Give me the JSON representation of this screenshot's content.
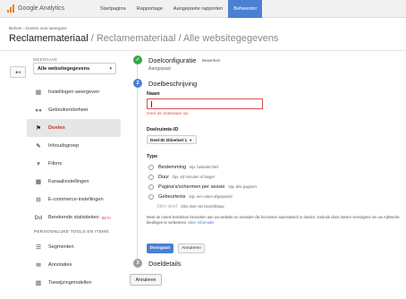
{
  "app": {
    "name": "Google Analytics",
    "brand_color": "#f57c00",
    "nav_tabs": [
      {
        "label": "Startpagina"
      },
      {
        "label": "Rapportage"
      },
      {
        "label": "Aangepaste rapporten"
      },
      {
        "label": "Beheerder",
        "active": true
      }
    ]
  },
  "breadcrumb": "Beheer › Doelen voor weergave",
  "page_title": {
    "main": "Reclamemateriaal",
    "sub": " / Reclamemateriaal / Alle websitegegevens"
  },
  "sidebar": {
    "back_icon": "arrow-left-icon",
    "view_label": "WEERGAVE",
    "view_selected": "Alle websitegegevens",
    "items": [
      {
        "label": "Instellingen weergeven",
        "icon": "document-icon",
        "glyph": "▤"
      },
      {
        "label": "Gebruikersbeheer",
        "icon": "users-icon",
        "glyph": "👥"
      },
      {
        "label": "Doelen",
        "icon": "flag-icon",
        "glyph": "⚑",
        "active": true
      },
      {
        "label": "Inhoudsgroep",
        "icon": "content-group-icon",
        "glyph": "✎"
      },
      {
        "label": "Filters",
        "icon": "filter-icon",
        "glyph": "▼"
      },
      {
        "label": "Kanaalinstellingen",
        "icon": "channel-icon",
        "glyph": "▦"
      },
      {
        "label": "E-commerce-instellingen",
        "icon": "cart-icon",
        "glyph": "🛒"
      },
      {
        "label": "Berekende statistieken",
        "icon": "dd-icon",
        "glyph": "Dd",
        "badge": "BETA"
      }
    ],
    "section_header": "PERSOONLIJKE TOOLS EN ITEMS",
    "tools": [
      {
        "label": "Segmenten",
        "icon": "segments-icon",
        "glyph": "☰"
      },
      {
        "label": "Annotaties",
        "icon": "annotations-icon",
        "glyph": "✉"
      },
      {
        "label": "Toewijzingmodellen",
        "icon": "attribution-icon",
        "glyph": "▥"
      }
    ]
  },
  "steps": {
    "step1": {
      "title": "Doelconfiguratie",
      "edit_label": "Bewerken",
      "status": "Aangepast"
    },
    "step2": {
      "number": "2",
      "title": "Doelbeschrijving",
      "name_label": "Naam",
      "name_value": "",
      "name_error": "Geef de doelnaam op",
      "slot_label": "Doelruimte-ID",
      "slot_value": "Doel-ID 2/doelset 1",
      "type_label": "Type",
      "types": [
        {
          "label": "Bestemming",
          "example": "bijv. bedankt.html"
        },
        {
          "label": "Duur",
          "example": "bijv. vijf minuten of langer"
        },
        {
          "label": "Pagina's/schermen per sessie",
          "example": "bijv. drie pagina's"
        },
        {
          "label": "Gebeurtenis",
          "example": "bijv. een video afgespeeld"
        }
      ],
      "smart_goal": {
        "label": "Slim doel",
        "note": "Slim doel niet beschikbaar"
      },
      "footnote": "Meet de meest betrokken bezoeken aan uw website en verander die bezoeken automatisch in doelen. Gebruik deze doelen vervolgens om uw AdWords-biedingen te verbeteren.",
      "footnote_link": "Meer informatie",
      "save_label": "Doorgaan",
      "cancel_label": "Annuleren"
    },
    "step3": {
      "number": "3",
      "title": "Doeldetails"
    }
  },
  "bottom_cancel_label": "Annuleren",
  "colors": {
    "accent": "#4a7fd4",
    "error": "#d9534f",
    "success": "#3aa845"
  }
}
